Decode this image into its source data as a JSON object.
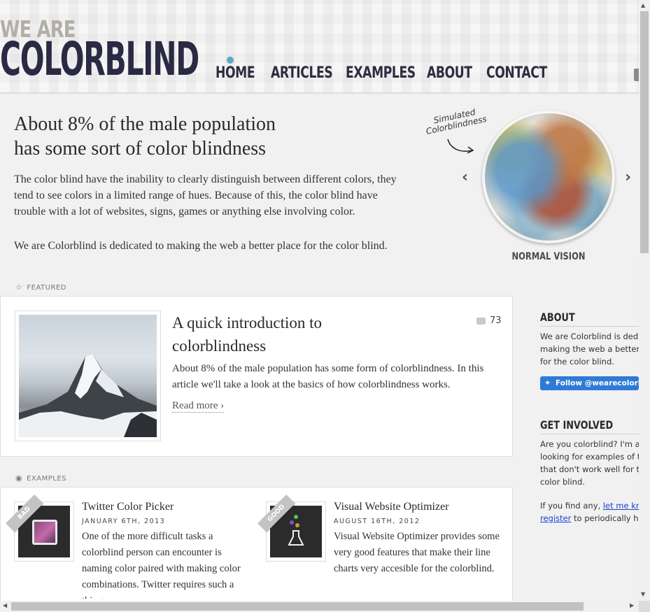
{
  "header": {
    "logo_small": "WE ARE",
    "logo_big": "COLORBLIND",
    "nav": [
      "HOME",
      "ARTICLES",
      "EXAMPLES",
      "ABOUT",
      "CONTACT"
    ],
    "active_nav": "HOME"
  },
  "intro": {
    "title_line1": "About 8% of the male population",
    "title_line2": "has some sort of color blindness",
    "paragraph1": "The color blind have the inability to clearly distinguish between different colors, they tend to see colors in a limited range of hues. Because of this, the color blind have trouble with a lot of websites, signs, games or anything else involving color.",
    "paragraph2": "We are Colorblind is dedicated to making the web a better place for the color blind."
  },
  "slider": {
    "note": "Simulated Colorblindness",
    "caption": "NORMAL VISION",
    "prev_icon": "chevron-left-icon",
    "next_icon": "chevron-right-icon"
  },
  "featured": {
    "label": "FEATURED",
    "title_line1": "A quick introduction to",
    "title_line2": "colorblindness",
    "comments": "73",
    "excerpt": "About 8% of the male population has some form of colorblindness. In this article we'll take a look at the basics of how colorblindness works.",
    "read_more": "Read more ›"
  },
  "examples": {
    "label": "EXAMPLES",
    "items": [
      {
        "badge": "BAD",
        "title": "Twitter Color Picker",
        "date": "JANUARY 6TH, 2013",
        "text": "One of the more difficult tasks a colorblind person can encounter is naming color paired with making color combinations. Twitter requires such a thing..."
      },
      {
        "badge": "GOOD",
        "title": "Visual Website Optimizer",
        "date": "AUGUST 16TH, 2012",
        "text": "Visual Website Optimizer provides some very good features that make their line charts very accesible for the colorblind."
      }
    ]
  },
  "sidebar": {
    "about_heading": "ABOUT",
    "about_lines": [
      "We are Colorblind is dedica",
      "making the web a better pl",
      "for the color blind."
    ],
    "twitter_label": "Follow @wearecolorblind",
    "involved_heading": "GET INVOLVED",
    "involved_lines": [
      "Are you colorblind? I'm alw",
      "looking for examples of thi",
      "that don't work well for the",
      "color blind."
    ],
    "find_prefix": "If you find any, ",
    "find_link": "let me know",
    "register_link": "register",
    "register_suffix": " to periodically help"
  },
  "colors": {
    "logo_dark": "#2a2a44",
    "logo_light": "#b3aea8",
    "nav_dot": "#5aa7c9",
    "twitter_blue": "#2f7ad6",
    "link_blue": "#1a3fcc"
  }
}
